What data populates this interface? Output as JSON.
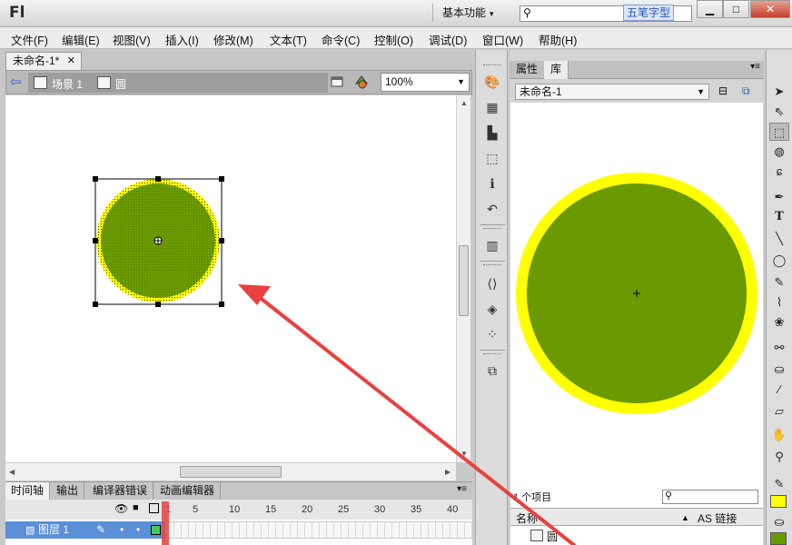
{
  "app": {
    "logo": "Fl",
    "workspace": "基本功能",
    "ime_badge": "五笔字型"
  },
  "menu": [
    "文件(F)",
    "编辑(E)",
    "视图(V)",
    "插入(I)",
    "修改(M)",
    "文本(T)",
    "命令(C)",
    "控制(O)",
    "调试(D)",
    "窗口(W)",
    "帮助(H)"
  ],
  "document": {
    "tab_title": "未命名-1*",
    "scene_label": "场景 1",
    "symbol_label": "圆",
    "zoom": "100%"
  },
  "timeline": {
    "tabs": [
      "时间轴",
      "输出",
      "编译器错误",
      "动画编辑器"
    ],
    "frame_numbers": [
      "1",
      "5",
      "10",
      "15",
      "20",
      "25",
      "30",
      "35",
      "40"
    ],
    "layer_name": "图层 1"
  },
  "library": {
    "tabs": [
      "属性",
      "库"
    ],
    "document_select": "未命名-1",
    "item_count": "1 个项目",
    "col_name": "名称",
    "col_linkage": "AS 链接",
    "items": [
      "圆"
    ]
  },
  "colors": {
    "circle_fill": "#6a9a00",
    "circle_stroke": "#ffff00",
    "arrow": "#e8413f",
    "stroke_swatch": "#ffff00",
    "fill_swatch": "#6a9a00"
  },
  "icons": [
    "back-arrow-icon",
    "scene-icon",
    "symbol-icon",
    "selection-tool-icon",
    "subselection-tool-icon",
    "free-transform-icon",
    "lasso-icon",
    "pen-icon",
    "text-icon",
    "line-icon",
    "oval-icon",
    "pencil-icon",
    "brush-icon",
    "bone-icon",
    "paint-bucket-icon",
    "eyedropper-icon",
    "eraser-icon",
    "hand-icon",
    "zoom-icon"
  ]
}
